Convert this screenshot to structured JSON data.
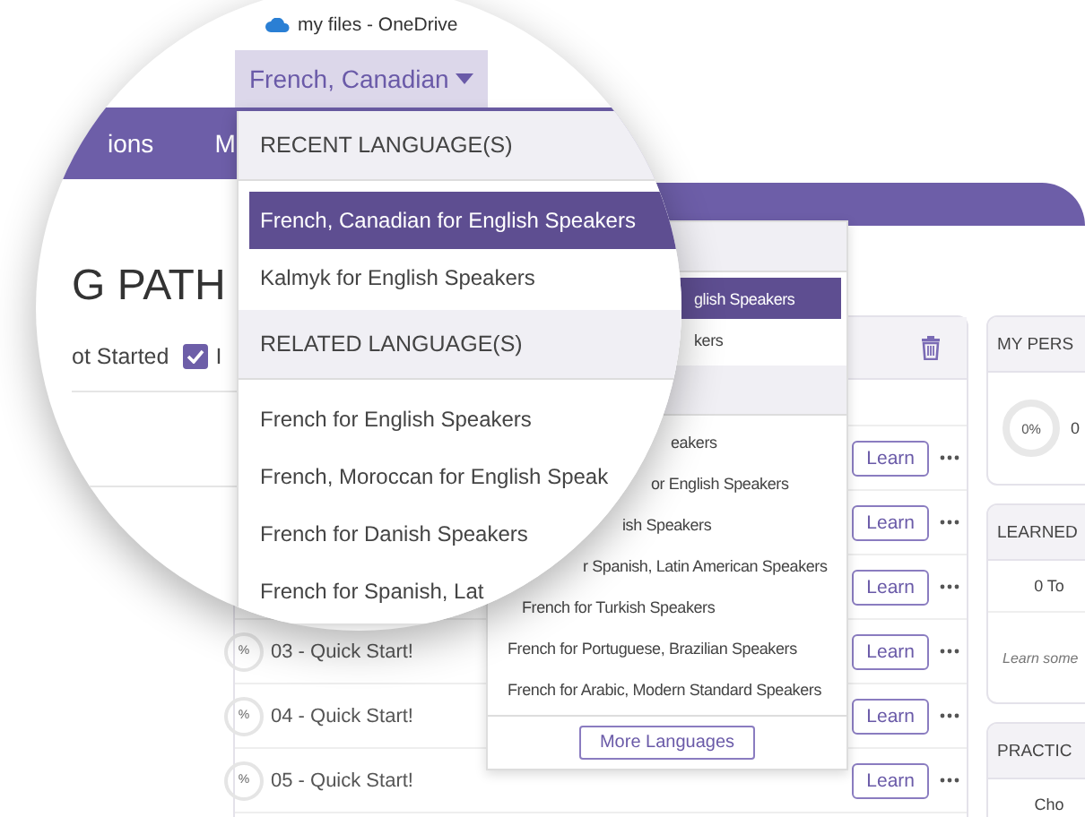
{
  "browser_tab": {
    "title": "my files - OneDrive"
  },
  "language_button": {
    "label": "French, Canadian",
    "expanded": true
  },
  "nav_tabs": [
    {
      "label": "ions"
    },
    {
      "label": "M"
    }
  ],
  "page": {
    "heading": "G PATH",
    "filters": [
      {
        "label": "ot Started"
      },
      {
        "label": "I",
        "checked": true
      }
    ]
  },
  "language_menu": {
    "sections": [
      {
        "heading": "RECENT LANGUAGE(S)",
        "items": [
          {
            "label": "French, Canadian for English Speakers",
            "selected": true
          },
          {
            "label": "Kalmyk for English Speakers",
            "selected": false
          }
        ]
      },
      {
        "heading": "RELATED LANGUAGE(S)",
        "items": [
          {
            "label": "French for English Speakers",
            "selected": false
          },
          {
            "label": "French, Moroccan for English Speak",
            "selected": false
          },
          {
            "label": "French for Danish Speakers",
            "selected": false
          },
          {
            "label": "French for Spanish, Lat",
            "selected": false
          }
        ]
      }
    ]
  },
  "language_menu_behind": {
    "sections": [
      {
        "items": [
          {
            "label": "glish Speakers",
            "selected": true
          },
          {
            "label": "kers",
            "selected": false
          }
        ]
      },
      {
        "items": [
          {
            "label": "eakers",
            "selected": false
          },
          {
            "label": "or English Speakers",
            "selected": false
          },
          {
            "label": "ish Speakers",
            "selected": false
          },
          {
            "label": "r Spanish, Latin American Speakers",
            "selected": false
          },
          {
            "label": "French for Turkish Speakers",
            "selected": false
          },
          {
            "label": "French for Portuguese, Brazilian Speakers",
            "selected": false
          },
          {
            "label": "French for Arabic, Modern Standard Speakers",
            "selected": false
          }
        ]
      }
    ],
    "more_button": "More Languages"
  },
  "lesson_list": {
    "rows": [
      {
        "action": "Learn"
      },
      {
        "action": "Learn"
      },
      {
        "action": "Learn"
      },
      {
        "badge": "%",
        "title": "03 - Quick Start!",
        "action": "Learn"
      },
      {
        "badge": "%",
        "title": "04 - Quick Start!",
        "action": "Learn"
      },
      {
        "badge": "%",
        "title": "05 - Quick Start!",
        "action": "Learn"
      }
    ]
  },
  "side_cards": [
    {
      "kind": "progress",
      "title": "MY PERS",
      "badge": "0%",
      "value": "0"
    },
    {
      "kind": "learned",
      "title": "LEARNED",
      "count": "0 To",
      "note": "Learn some"
    },
    {
      "kind": "practice",
      "title": "PRACTIC",
      "text": "Cho"
    }
  ]
}
